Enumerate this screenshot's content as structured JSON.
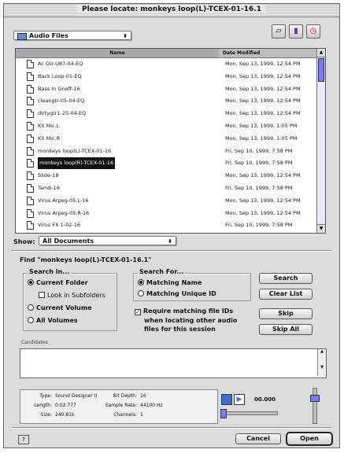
{
  "window": {
    "title": "Please locate: monkeys loop(L)-TCEX-01-16.1"
  },
  "location_popup": {
    "label": "Audio Files"
  },
  "toolbar_icons": [
    "desktop-icon",
    "folder-icon",
    "recent-icon"
  ],
  "file_list": {
    "headers": {
      "name": "Name",
      "date": "Date Modified"
    },
    "rows": [
      {
        "name": "Ac Gtr-U87-04-EQ",
        "date": "Mon, Sep 13, 1999, 12:54 PM",
        "selected": false
      },
      {
        "name": "Back Loop-01-EQ",
        "date": "Mon, Sep 13, 1999, 12:54 PM",
        "selected": false
      },
      {
        "name": "Bass In Gneff-16",
        "date": "Mon, Sep 13, 1999, 12:54 PM",
        "selected": false
      },
      {
        "name": "cleangtr-05-04-EQ",
        "date": "Mon, Sep 13, 1999, 12:54 PM",
        "selected": false
      },
      {
        "name": "dirtygtr1-25-04-EQ",
        "date": "Mon, Sep 13, 1999, 12:54 PM",
        "selected": false
      },
      {
        "name": "Kit Mic.L",
        "date": "Mon, Sep 13, 1999, 1:05 PM",
        "selected": false
      },
      {
        "name": "Kit Mic.R",
        "date": "Mon, Sep 13, 1999, 1:05 PM",
        "selected": false
      },
      {
        "name": "monkeys loop(L)-TCEX-01-16",
        "date": "Fri, Sep 10, 1999, 7:58 PM",
        "selected": false
      },
      {
        "name": "monkeys loop(R)-TCEX-01-16",
        "date": "Fri, Sep 10, 1999, 7:58 PM",
        "selected": true
      },
      {
        "name": "Slide-18",
        "date": "Mon, Sep 13, 1999, 12:54 PM",
        "selected": false
      },
      {
        "name": "Tamb-16",
        "date": "Fri, Sep 10, 1999, 7:58 PM",
        "selected": false
      },
      {
        "name": "Virus Arpeg-05.L-16",
        "date": "Mon, Sep 13, 1999, 12:54 PM",
        "selected": false
      },
      {
        "name": "Virus Arpeg-05.R-16",
        "date": "Mon, Sep 13, 1999, 12:54 PM",
        "selected": false
      },
      {
        "name": "Virus FX 1-02-16",
        "date": "Fri, Sep 10, 1999, 7:58 PM",
        "selected": false
      }
    ]
  },
  "show": {
    "label": "Show:",
    "value": "All Documents"
  },
  "find": {
    "text": "Find \"monkeys loop(L)-TCEX-01-16.1\""
  },
  "search_in": {
    "title": "Search in...",
    "current_folder": "Current Folder",
    "look_in_subfolders": "Look in Subfolders",
    "current_volume": "Current Volume",
    "all_volumes": "All Volumes"
  },
  "search_for": {
    "title": "Search For...",
    "matching_name": "Matching Name",
    "matching_unique_id": "Matching Unique ID",
    "require_line1": "Require matching file IDs",
    "require_line2": "when locating other audio",
    "require_line3": "files for this session"
  },
  "buttons": {
    "search": "Search",
    "clear_list": "Clear List",
    "skip": "Skip",
    "skip_all": "Skip All",
    "cancel": "Cancel",
    "open": "Open"
  },
  "candidates": {
    "label": "Candidates"
  },
  "info": {
    "type_label": "Type:",
    "type_value": "Sound Designer II",
    "length_label": "Length:",
    "length_value": "0:02.777",
    "size_label": "Size:",
    "size_value": "240.61k",
    "bitdepth_label": "Bit Depth:",
    "bitdepth_value": "16",
    "samplerate_label": "Sample Rate:",
    "samplerate_value": "44100 Hz",
    "channels_label": "Channels:",
    "channels_value": "1"
  },
  "preview": {
    "time": "00.000",
    "volume_level": 0.8
  }
}
